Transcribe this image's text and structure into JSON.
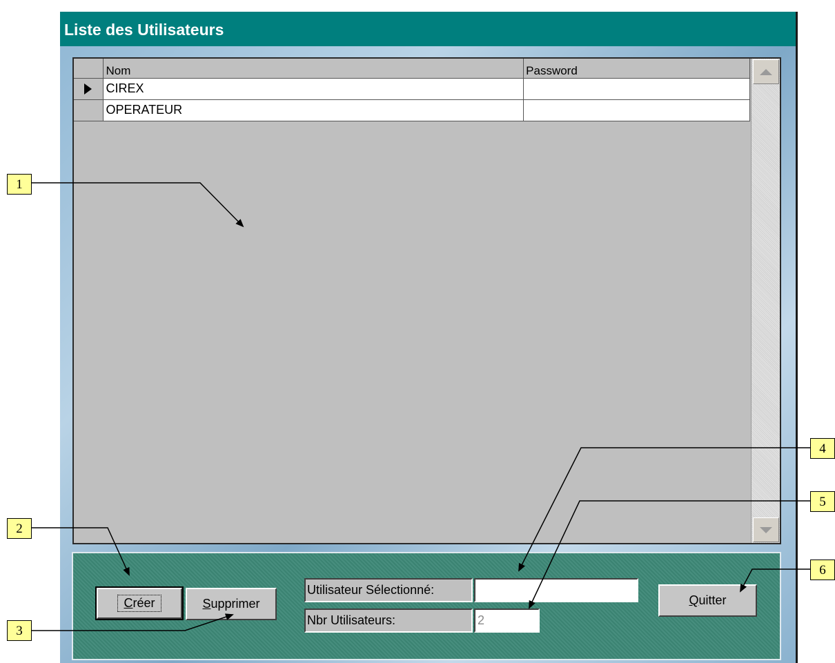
{
  "window": {
    "title": "Liste des Utilisateurs"
  },
  "grid": {
    "columns": [
      "Nom",
      "Password"
    ],
    "rows": [
      {
        "nom": "CIREX",
        "password": "",
        "current": true
      },
      {
        "nom": "OPERATEUR",
        "password": "",
        "current": false
      }
    ]
  },
  "buttons": {
    "creer": {
      "accel": "C",
      "rest": "réer"
    },
    "supprimer": {
      "accel": "S",
      "rest": "upprimer"
    },
    "quitter": {
      "accel": "Q",
      "rest": "uitter"
    }
  },
  "fields": {
    "selected_user_label": "Utilisateur Sélectionné:",
    "selected_user_value": "",
    "count_label": "Nbr Utilisateurs:",
    "count_value": "2"
  },
  "callouts": [
    "1",
    "2",
    "3",
    "4",
    "5",
    "6"
  ]
}
